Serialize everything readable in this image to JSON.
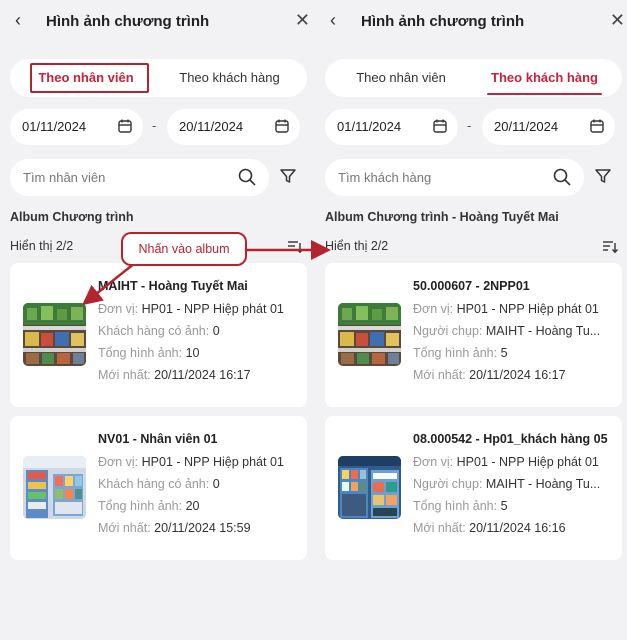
{
  "colors": {
    "accent": "#c3233b",
    "annotation": "#b3242f",
    "background": "#f2f2f4"
  },
  "left": {
    "header": {
      "title": "Hình ảnh chương trình",
      "back_icon": "chevron-left-icon",
      "close_icon": "close-icon"
    },
    "tabs": [
      {
        "label": "Theo nhân viên",
        "active": true
      },
      {
        "label": "Theo khách hàng",
        "active": false
      }
    ],
    "date_from": "01/11/2024",
    "date_to": "20/11/2024",
    "search_placeholder": "Tìm nhân viên",
    "section_title": "Album Chương trình",
    "count_label": "Hiển thị 2/2",
    "cards": [
      {
        "name": "MAIHT - Hoàng Tuyết Mai",
        "lines": [
          {
            "k": "Đơn vị:",
            "v": "HP01 - NPP Hiệp phát 01"
          },
          {
            "k": "Khách hàng có ảnh:",
            "v": "0"
          },
          {
            "k": "Tổng hình ảnh:",
            "v": "10"
          },
          {
            "k": "Mới nhất:",
            "v": "20/11/2024 16:17"
          }
        ]
      },
      {
        "name": "NV01 - Nhân viên 01",
        "lines": [
          {
            "k": "Đơn vị:",
            "v": "HP01 - NPP Hiệp phát 01"
          },
          {
            "k": "Khách hàng có ảnh:",
            "v": "0"
          },
          {
            "k": "Tổng hình ảnh:",
            "v": "20"
          },
          {
            "k": "Mới nhất:",
            "v": "20/11/2024 15:59"
          }
        ]
      }
    ]
  },
  "right": {
    "header": {
      "title": "Hình ảnh chương trình",
      "back_icon": "chevron-left-icon",
      "close_icon": "close-icon"
    },
    "tabs": [
      {
        "label": "Theo nhân viên",
        "active": false
      },
      {
        "label": "Theo khách hàng",
        "active": true
      }
    ],
    "date_from": "01/11/2024",
    "date_to": "20/11/2024",
    "search_placeholder": "Tìm khách hàng",
    "section_title": "Album Chương trình - Hoàng Tuyết Mai",
    "count_label": "Hiển thị 2/2",
    "cards": [
      {
        "name": "50.000607 - 2NPP01",
        "lines": [
          {
            "k": "Đơn vị:",
            "v": "HP01 - NPP Hiệp phát 01"
          },
          {
            "k": "Người chụp:",
            "v": "MAIHT - Hoàng Tu..."
          },
          {
            "k": "Tổng hình ảnh:",
            "v": "5"
          },
          {
            "k": "Mới nhất:",
            "v": "20/11/2024 16:17"
          }
        ]
      },
      {
        "name": "08.000542 - Hp01_khách hàng 05",
        "lines": [
          {
            "k": "Đơn vị:",
            "v": "HP01 - NPP Hiệp phát 01"
          },
          {
            "k": "Người chụp:",
            "v": "MAIHT - Hoàng Tu..."
          },
          {
            "k": "Tổng hình ảnh:",
            "v": "5"
          },
          {
            "k": "Mới nhất:",
            "v": "20/11/2024 16:16"
          }
        ]
      }
    ]
  },
  "annotation": {
    "callout_text": "Nhấn vào album"
  }
}
